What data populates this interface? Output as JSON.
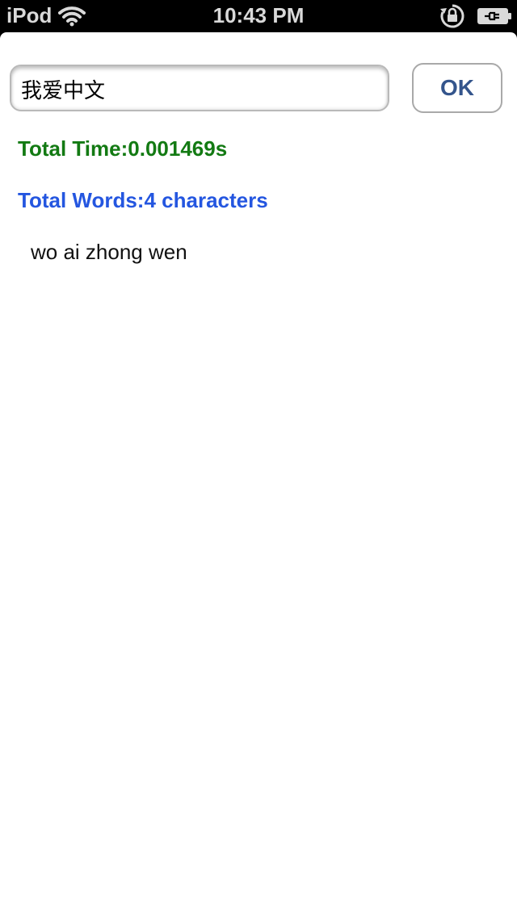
{
  "status_bar": {
    "carrier": "iPod",
    "time": "10:43 PM",
    "icons": [
      "wifi-icon",
      "rotation-lock-icon",
      "battery-charging-icon"
    ]
  },
  "input": {
    "value": "我爱中文"
  },
  "ok_button": {
    "label": "OK"
  },
  "results": {
    "total_time": "Total Time:0.001469s",
    "total_words": "Total Words:4 characters",
    "pinyin": "wo ai zhong wen"
  },
  "colors": {
    "time_text": "#137a13",
    "words_text": "#2456e0",
    "button_text": "#34558c"
  }
}
